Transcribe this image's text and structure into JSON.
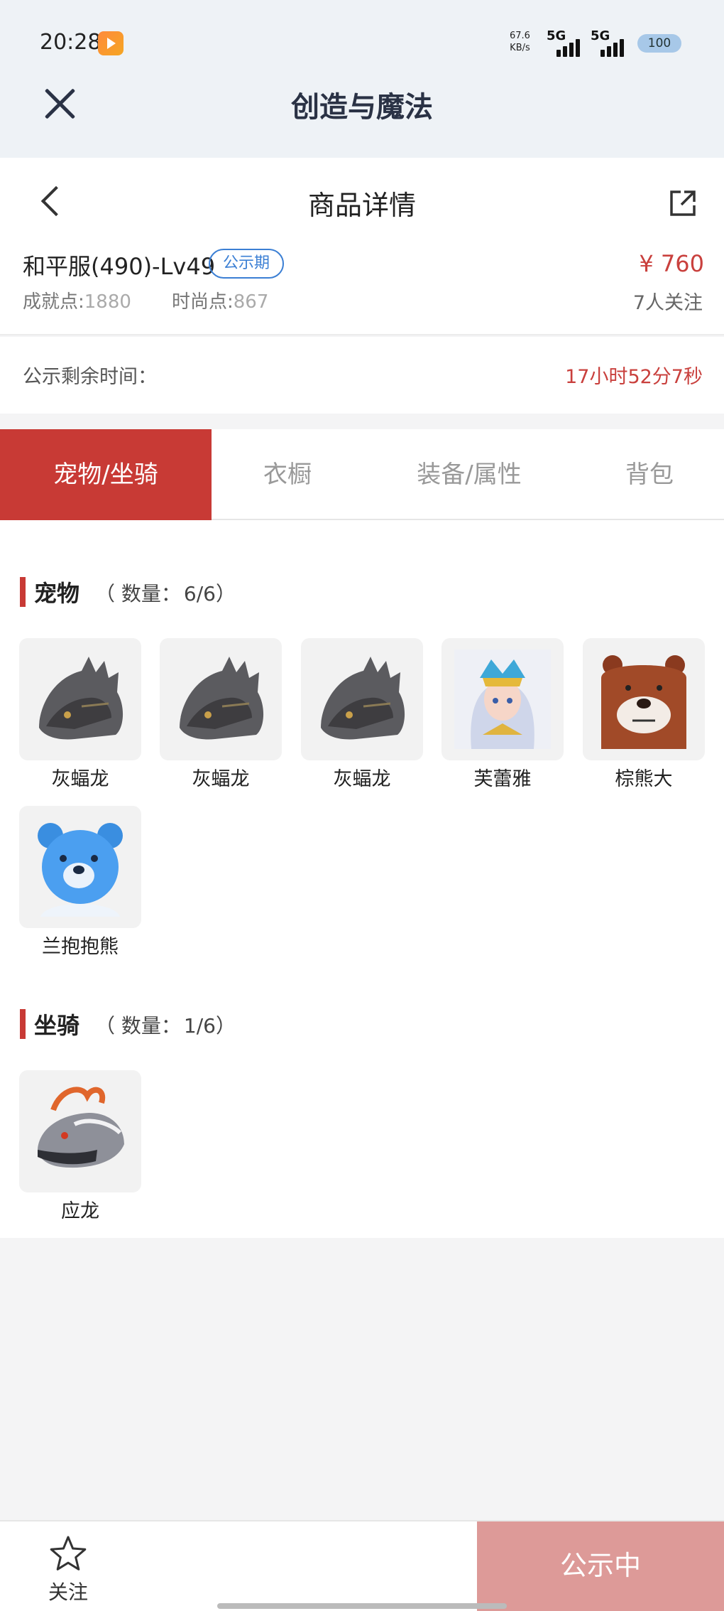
{
  "status_bar": {
    "time": "20:28",
    "net_speed": "67.6",
    "net_unit": "KB/s",
    "signal1": "5G",
    "signal2": "5G",
    "battery": "100"
  },
  "app_header": {
    "title": "创造与魔法",
    "close_icon": "close-icon"
  },
  "page_header": {
    "title": "商品详情",
    "back_icon": "chevron-left-icon",
    "share_icon": "share-icon"
  },
  "product": {
    "server": "和平服(490)-Lv49",
    "badge": "公示期",
    "price": "¥ 760",
    "achievement_label": "成就点:",
    "achievement_value": "1880",
    "fashion_label": "时尚点:",
    "fashion_value": "867",
    "followers": "7人关注"
  },
  "timer": {
    "label": "公示剩余时间：",
    "value": "17小时52分7秒"
  },
  "tabs": [
    {
      "label": "宠物/坐骑",
      "active": true
    },
    {
      "label": "衣橱",
      "active": false
    },
    {
      "label": "装备/属性",
      "active": false
    },
    {
      "label": "背包",
      "active": false
    }
  ],
  "pets": {
    "title": "宠物",
    "count_prefix": "（ 数量：",
    "count": "6/6",
    "count_suffix": "）",
    "items": [
      {
        "name": "灰蝠龙"
      },
      {
        "name": "灰蝠龙"
      },
      {
        "name": "灰蝠龙"
      },
      {
        "name": "芙蕾雅"
      },
      {
        "name": "棕熊大"
      },
      {
        "name": "兰抱抱熊"
      }
    ]
  },
  "mounts": {
    "title": "坐骑",
    "count_prefix": "（ 数量：",
    "count": "1/6",
    "count_suffix": "）",
    "items": [
      {
        "name": "应龙"
      }
    ]
  },
  "bottom_bar": {
    "follow_label": "关注",
    "status_button": "公示中"
  },
  "colors": {
    "accent_red": "#c83a35",
    "badge_blue": "#3b7fd4",
    "disabled_button": "#dd9a98"
  }
}
